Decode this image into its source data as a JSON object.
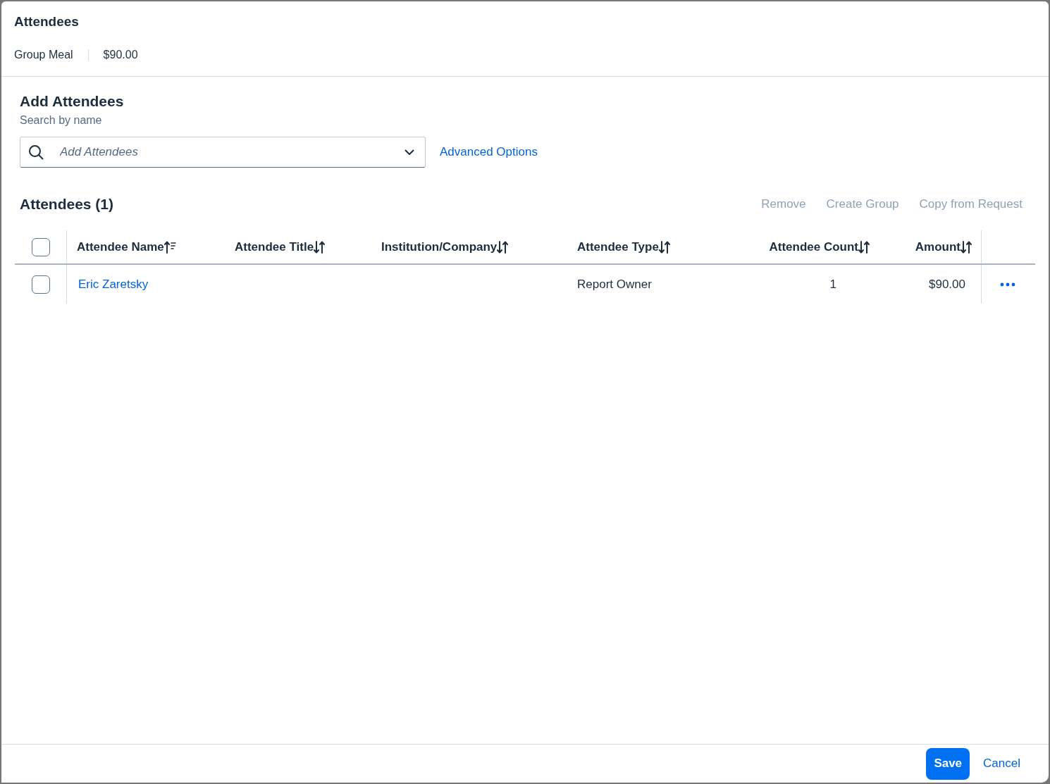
{
  "dialog": {
    "title": "Attendees",
    "expense_type": "Group Meal",
    "expense_amount": "$90.00"
  },
  "add_attendees": {
    "heading": "Add Attendees",
    "label": "Search by name",
    "search": {
      "placeholder": "Add Attendees"
    },
    "link": "Advanced Options"
  },
  "attendees": {
    "heading": "Attendees (1)",
    "actions": [
      {
        "label": "Remove",
        "disabled": true
      },
      {
        "label": "Create Group",
        "disabled": true
      },
      {
        "label": "Copy from Request",
        "disabled": true
      }
    ],
    "table": {
      "select_all": {
        "checked": false
      },
      "columns": [
        {
          "label": "Attendee Name",
          "sorted": true
        },
        {
          "label": "Attendee Title",
          "sorted": false
        },
        {
          "label": "Institution/Company",
          "sorted": false
        },
        {
          "label": "Attendee Type",
          "sorted": false
        },
        {
          "label": "Attendee Count",
          "sorted": false
        },
        {
          "label": "Amount",
          "sorted": false
        }
      ],
      "rows": [
        {
          "checked": false,
          "name": "Eric Zaretsky",
          "type": "Report Owner",
          "count": "1",
          "amount": "$90.00"
        }
      ]
    }
  },
  "footer": {
    "buttons": [
      {
        "label": "Save",
        "kind": "primary"
      },
      {
        "label": "Cancel",
        "kind": "link"
      }
    ]
  }
}
